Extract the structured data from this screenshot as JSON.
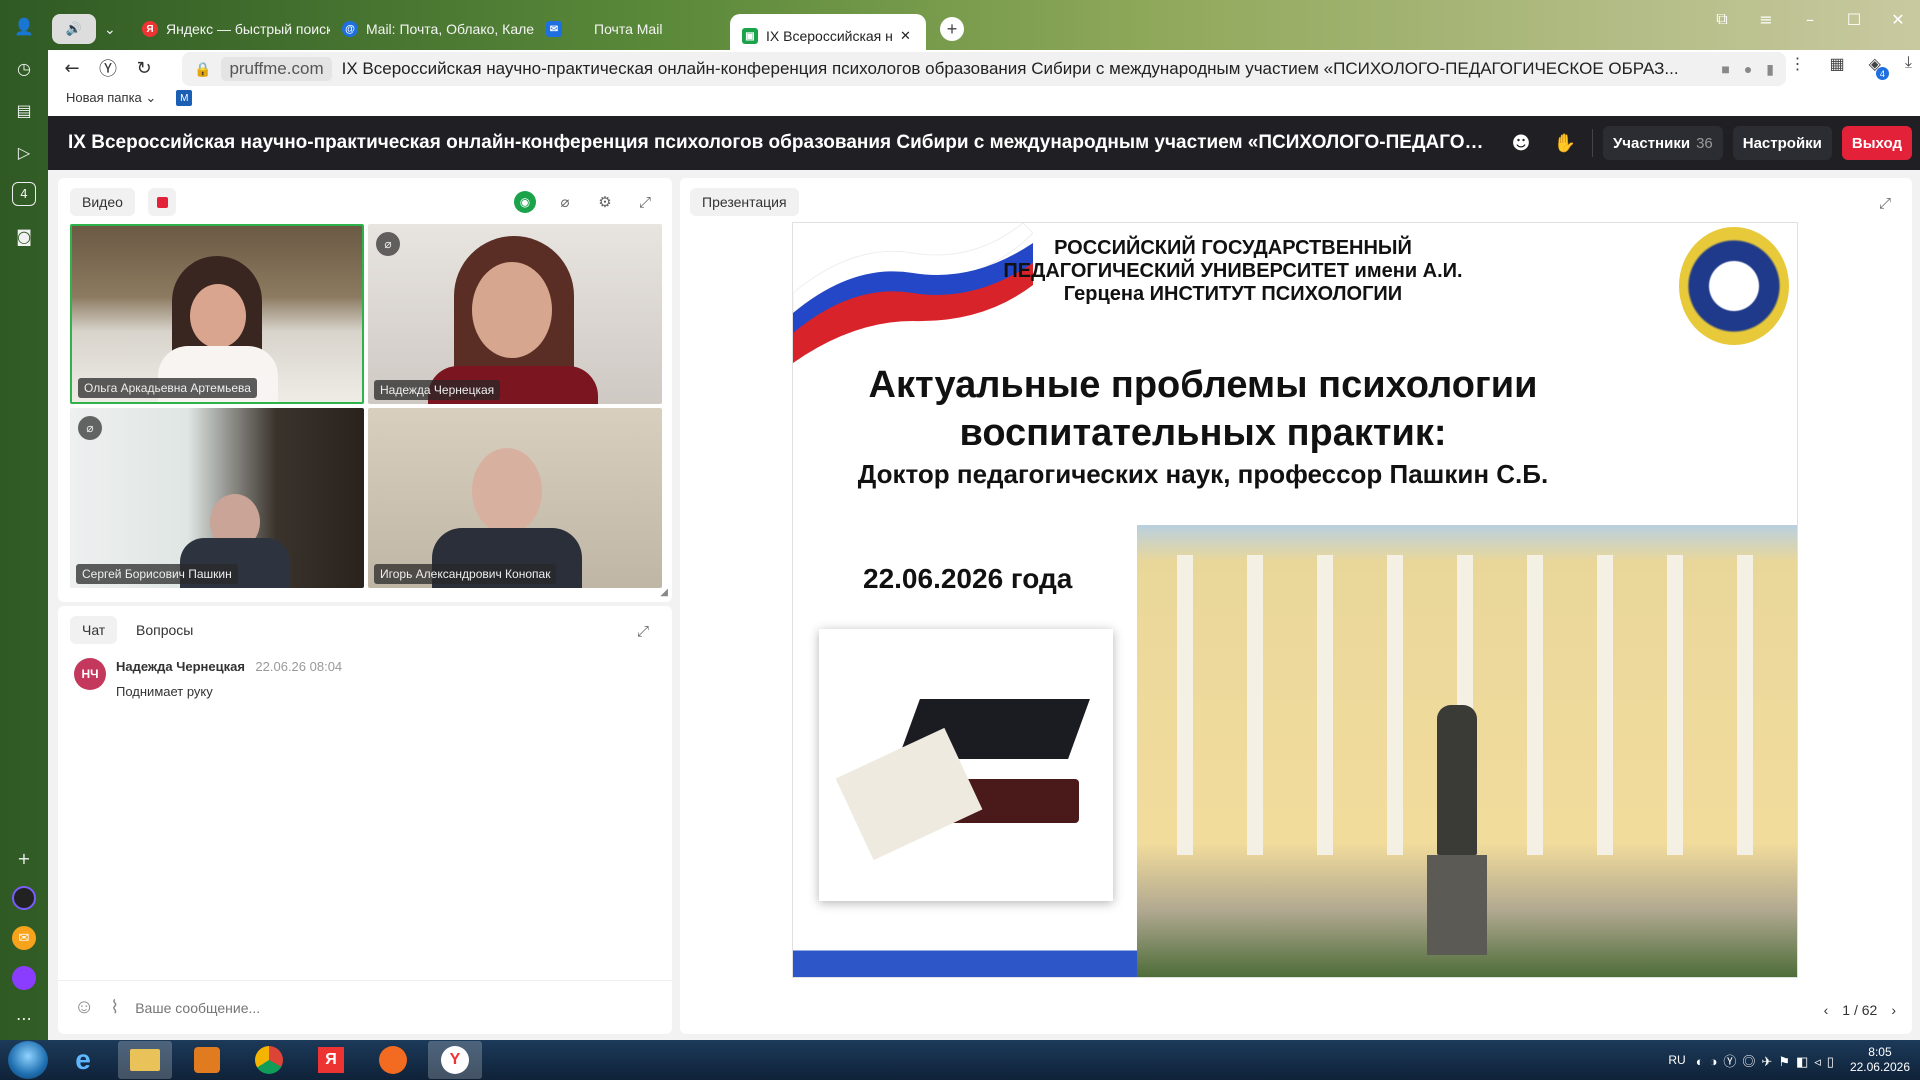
{
  "browser": {
    "tabs": [
      {
        "label": "Яндекс — быстрый поиск",
        "favicon": "yandex-icon",
        "color": "#e33"
      },
      {
        "label": "Mail: Почта, Облако, Кале",
        "favicon": "at-icon",
        "color": "#1e6fe0"
      },
      {
        "label": "Почта Mail",
        "favicon": "mail-icon",
        "color": "#1e6fe0"
      },
      {
        "label": "IX Всероссийская на",
        "favicon": "conference-icon",
        "color": "#1aa34a"
      }
    ],
    "domain": "pruffme.com",
    "page_title": "IX Всероссийская научно-практическая онлайн-конференция психологов образования Сибири с международным участием «ПСИХОЛОГО-ПЕДАГОГИЧЕСКОЕ ОБРАЗ...",
    "bookmark_folder": "Новая папка",
    "bookmark_letter": "M",
    "ext_badge": "4"
  },
  "conference": {
    "title": "IX Всероссийская научно-практическая онлайн-конференция психологов образования Сибири с международным участием «ПСИХОЛОГО-ПЕДАГОГИЧЕСКОЕ О...",
    "participants_label": "Участники",
    "participants_count": "36",
    "settings_label": "Настройки",
    "exit_label": "Выход",
    "accent_exit": "#e3223a"
  },
  "video": {
    "label": "Видео",
    "participants": [
      {
        "name": "Ольга Аркадьевна Артемьева",
        "muted": false,
        "speaking": true
      },
      {
        "name": "Надежда Чернецкая",
        "muted": true,
        "speaking": false
      },
      {
        "name": "Сергей Борисович Пашкин",
        "muted": true,
        "speaking": false
      },
      {
        "name": "Игорь Александрович Конопак",
        "muted": false,
        "speaking": false
      }
    ]
  },
  "chat": {
    "tabs": [
      "Чат",
      "Вопросы"
    ],
    "messages": [
      {
        "initials": "НЧ",
        "author": "Надежда Чернецкая",
        "time": "22.06.26 08:04",
        "text": "Поднимает руку"
      }
    ],
    "placeholder": "Ваше сообщение..."
  },
  "presentation": {
    "label": "Презентация",
    "university": "РОССИЙСКИЙ ГОСУДАРСТВЕННЫЙ ПЕДАГОГИЧЕСКИЙ УНИВЕРСИТЕТ имени А.И. Герцена ИНСТИТУТ ПСИХОЛОГИИ",
    "heading": "Актуальные проблемы психологии воспитательных практик:",
    "subheading": "Доктор педагогических наук, профессор Пашкин С.Б.",
    "date": "22.06.2026 года",
    "page": "1 / 62"
  },
  "taskbar": {
    "lang": "RU",
    "time": "8:05",
    "date": "22.06.2026"
  }
}
